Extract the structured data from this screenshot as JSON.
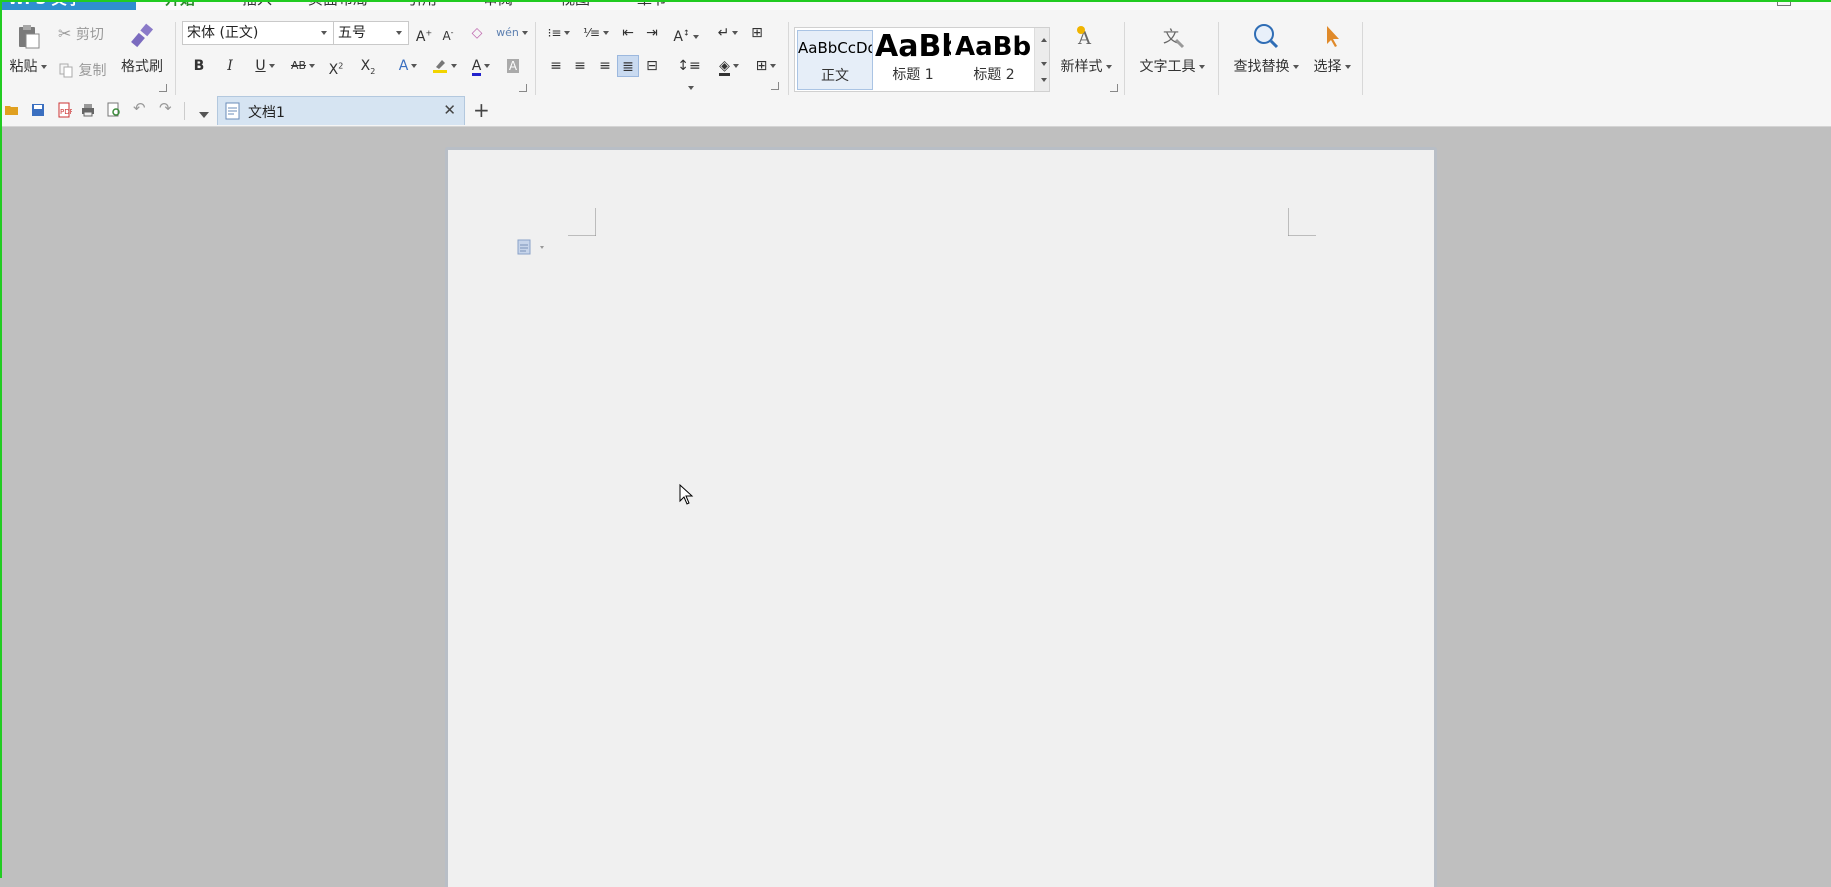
{
  "app": {
    "menu_button": "WPS 文字",
    "tabs": [
      {
        "label": "开始",
        "active": true
      },
      {
        "label": "插入"
      },
      {
        "label": "页面布局"
      },
      {
        "label": "引用"
      },
      {
        "label": "审阅"
      },
      {
        "label": "视图"
      },
      {
        "label": "章节"
      }
    ]
  },
  "ribbon": {
    "clipboard": {
      "paste": "粘贴",
      "cut": "剪切",
      "copy": "复制",
      "format_painter": "格式刷"
    },
    "font": {
      "font_name": "宋体 (正文)",
      "font_size": "五号"
    },
    "styles": [
      {
        "preview": "AaBbCcDd",
        "label": "正文",
        "selected": true
      },
      {
        "preview": "AaBb",
        "label": "标题 1"
      },
      {
        "preview": "AaBb(",
        "label": "标题 2"
      }
    ],
    "new_style": "新样式",
    "text_tools": "文字工具",
    "find_replace": "查找替换",
    "select": "选择"
  },
  "document": {
    "tab_title": "文档1"
  },
  "colors": {
    "accent": "#2f8fcf",
    "font_color_bar": "#2222cc",
    "highlight_bar": "#f2d400"
  }
}
